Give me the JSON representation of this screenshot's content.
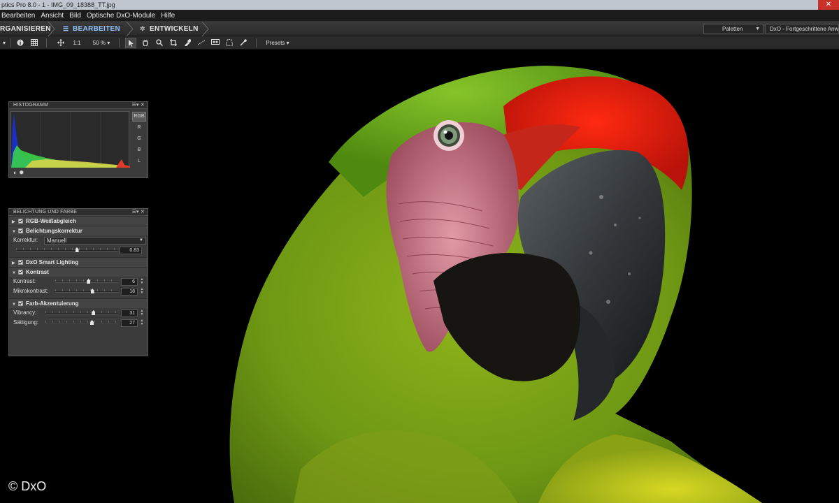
{
  "window": {
    "title": "ptics Pro 8.0 - 1 - IMG_09_18388_TT.jpg",
    "close_glyph": "✕"
  },
  "menu": [
    "Bearbeiten",
    "Ansicht",
    "Bild",
    "Optische DxO-Module",
    "Hilfe"
  ],
  "workspace_tabs": [
    {
      "label": "RGANISIEREN",
      "icon": "organize-icon",
      "active": false
    },
    {
      "label": "BEARBEITEN",
      "icon": "sliders-icon",
      "active": true
    },
    {
      "label": "ENTWICKELN",
      "icon": "gear-icon",
      "active": false
    }
  ],
  "palette_dropdown": {
    "label": "Paletten"
  },
  "workspace_dropdown": {
    "label": "DxO - Fortgeschrittene Anwen"
  },
  "toolbar": {
    "zoom_1to1": "1:1",
    "zoom_level": "50 %",
    "presets": "Presets",
    "icons": [
      "info-icon",
      "grid-icon",
      "move-icon",
      "pointer-icon",
      "hand-icon",
      "zoom-icon",
      "crop-icon",
      "repair-icon",
      "horizon-icon",
      "redeye-icon",
      "perspective-icon",
      "eyedropper-icon"
    ]
  },
  "histogram": {
    "title": "HISTOGRAMM",
    "channels": [
      "RGB",
      "R",
      "G",
      "B",
      "L"
    ],
    "selected_channel": "RGB",
    "colors": {
      "blue": "#1a2fd9",
      "green": "#3ad24a",
      "yellow": "#d7d44a",
      "red": "#e03a2a"
    }
  },
  "exposure_panel": {
    "title": "BELICHTUNG UND FARBE",
    "sections": [
      {
        "label": "RGB-Weißabgleich",
        "expanded": false,
        "enabled": true
      },
      {
        "label": "Belichtungskorrektur",
        "expanded": true,
        "enabled": true,
        "correction_label": "Korrektur:",
        "correction_value": "Manuell",
        "value": "0.83",
        "level": 0.6
      },
      {
        "label": "DxO Smart Lighting",
        "expanded": false,
        "enabled": true
      },
      {
        "label": "Kontrast",
        "expanded": true,
        "enabled": true,
        "controls": [
          {
            "label": "Kontrast:",
            "value": "6",
            "level": 0.53
          },
          {
            "label": "Mikrokontrast:",
            "value": "18",
            "level": 0.59
          }
        ]
      },
      {
        "label": "Farb-Akzentuierung",
        "expanded": true,
        "enabled": true,
        "controls": [
          {
            "label": "Vibrancy:",
            "value": "31",
            "level": 0.66
          },
          {
            "label": "Sättigung:",
            "value": "27",
            "level": 0.64
          }
        ]
      }
    ]
  },
  "photo": {
    "subject": "parrot-photo"
  },
  "copyright": "© DxO"
}
